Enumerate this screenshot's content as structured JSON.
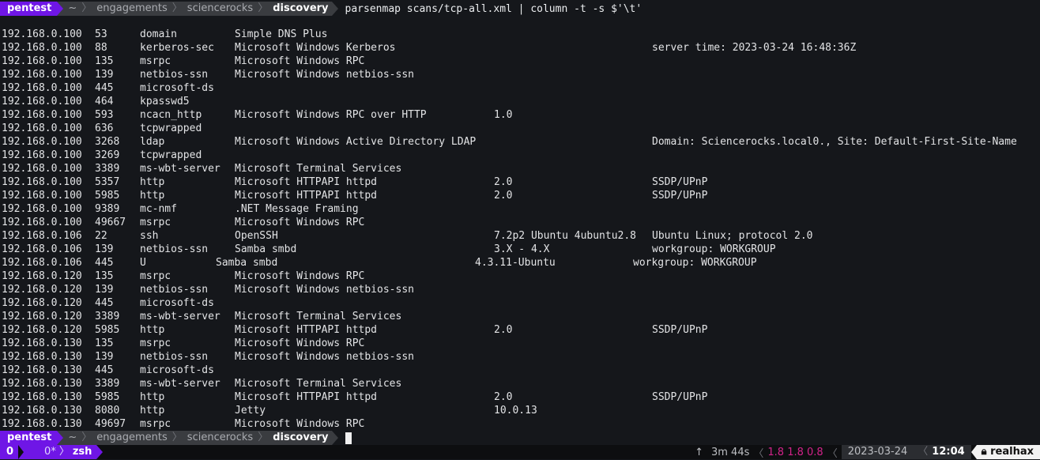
{
  "prompt": {
    "host": "pentest",
    "home": "~",
    "path": [
      "engagements",
      "sciencerocks"
    ],
    "current_dir": "discovery",
    "command": "parsenmap scans/tcp-all.xml | column -t -s $'\\t'"
  },
  "prompt2": {
    "host": "pentest",
    "home": "~",
    "path": [
      "engagements",
      "sciencerocks"
    ],
    "current_dir": "discovery"
  },
  "rows": [
    [
      "192.168.0.100",
      "53",
      "domain",
      "Simple DNS Plus",
      "",
      ""
    ],
    [
      "192.168.0.100",
      "88",
      "kerberos-sec",
      "Microsoft Windows Kerberos",
      "",
      "server time: 2023-03-24 16:48:36Z"
    ],
    [
      "192.168.0.100",
      "135",
      "msrpc",
      "Microsoft Windows RPC",
      "",
      ""
    ],
    [
      "192.168.0.100",
      "139",
      "netbios-ssn",
      "Microsoft Windows netbios-ssn",
      "",
      ""
    ],
    [
      "192.168.0.100",
      "445",
      "microsoft-ds",
      "",
      "",
      ""
    ],
    [
      "192.168.0.100",
      "464",
      "kpasswd5",
      "",
      "",
      ""
    ],
    [
      "192.168.0.100",
      "593",
      "ncacn_http",
      "Microsoft Windows RPC over HTTP",
      "1.0",
      ""
    ],
    [
      "192.168.0.100",
      "636",
      "tcpwrapped",
      "",
      "",
      ""
    ],
    [
      "192.168.0.100",
      "3268",
      "ldap",
      "Microsoft Windows Active Directory LDAP",
      "",
      "Domain: Sciencerocks.local0., Site: Default-First-Site-Name"
    ],
    [
      "192.168.0.100",
      "3269",
      "tcpwrapped",
      "",
      "",
      ""
    ],
    [
      "192.168.0.100",
      "3389",
      "ms-wbt-server",
      "Microsoft Terminal Services",
      "",
      ""
    ],
    [
      "192.168.0.100",
      "5357",
      "http",
      "Microsoft HTTPAPI httpd",
      "2.0",
      "SSDP/UPnP"
    ],
    [
      "192.168.0.100",
      "5985",
      "http",
      "Microsoft HTTPAPI httpd",
      "2.0",
      "SSDP/UPnP"
    ],
    [
      "192.168.0.100",
      "9389",
      "mc-nmf",
      ".NET Message Framing",
      "",
      ""
    ],
    [
      "192.168.0.100",
      "49667",
      "msrpc",
      "Microsoft Windows RPC",
      "",
      ""
    ],
    [
      "192.168.0.106",
      "22",
      "ssh",
      "OpenSSH",
      "7.2p2 Ubuntu 4ubuntu2.8",
      "Ubuntu Linux; protocol 2.0"
    ],
    [
      "192.168.0.106",
      "139",
      "netbios-ssn",
      "Samba smbd",
      "3.X - 4.X",
      "workgroup: WORKGROUP"
    ],
    [
      "192.168.0.106",
      "445",
      "U",
      "Samba smbd",
      "4.3.11-Ubuntu",
      "workgroup: WORKGROUP"
    ],
    [
      "192.168.0.120",
      "135",
      "msrpc",
      "Microsoft Windows RPC",
      "",
      ""
    ],
    [
      "192.168.0.120",
      "139",
      "netbios-ssn",
      "Microsoft Windows netbios-ssn",
      "",
      ""
    ],
    [
      "192.168.0.120",
      "445",
      "microsoft-ds",
      "",
      "",
      ""
    ],
    [
      "192.168.0.120",
      "3389",
      "ms-wbt-server",
      "Microsoft Terminal Services",
      "",
      ""
    ],
    [
      "192.168.0.120",
      "5985",
      "http",
      "Microsoft HTTPAPI httpd",
      "2.0",
      "SSDP/UPnP"
    ],
    [
      "192.168.0.130",
      "135",
      "msrpc",
      "Microsoft Windows RPC",
      "",
      ""
    ],
    [
      "192.168.0.130",
      "139",
      "netbios-ssn",
      "Microsoft Windows netbios-ssn",
      "",
      ""
    ],
    [
      "192.168.0.130",
      "445",
      "microsoft-ds",
      "",
      "",
      ""
    ],
    [
      "192.168.0.130",
      "3389",
      "ms-wbt-server",
      "Microsoft Terminal Services",
      "",
      ""
    ],
    [
      "192.168.0.130",
      "5985",
      "http",
      "Microsoft HTTPAPI httpd",
      "2.0",
      "SSDP/UPnP"
    ],
    [
      "192.168.0.130",
      "8080",
      "http",
      "Jetty",
      "10.0.13",
      ""
    ],
    [
      "192.168.0.130",
      "49697",
      "msrpc",
      "Microsoft Windows RPC",
      "",
      ""
    ]
  ],
  "shifted_rows": [
    17
  ],
  "statusbar": {
    "session_index": "0",
    "window": "0*",
    "window_name": "zsh",
    "up_arrow": "↑",
    "uptime": "3m 44s",
    "load": "1.8 1.8 0.8",
    "date": "2023-03-24",
    "time": "12:04",
    "lock_icon": "lock-icon",
    "user": "realhax"
  },
  "colors": {
    "accent": "#6f16e6",
    "load": "#d3238a",
    "background": "#15171b"
  }
}
